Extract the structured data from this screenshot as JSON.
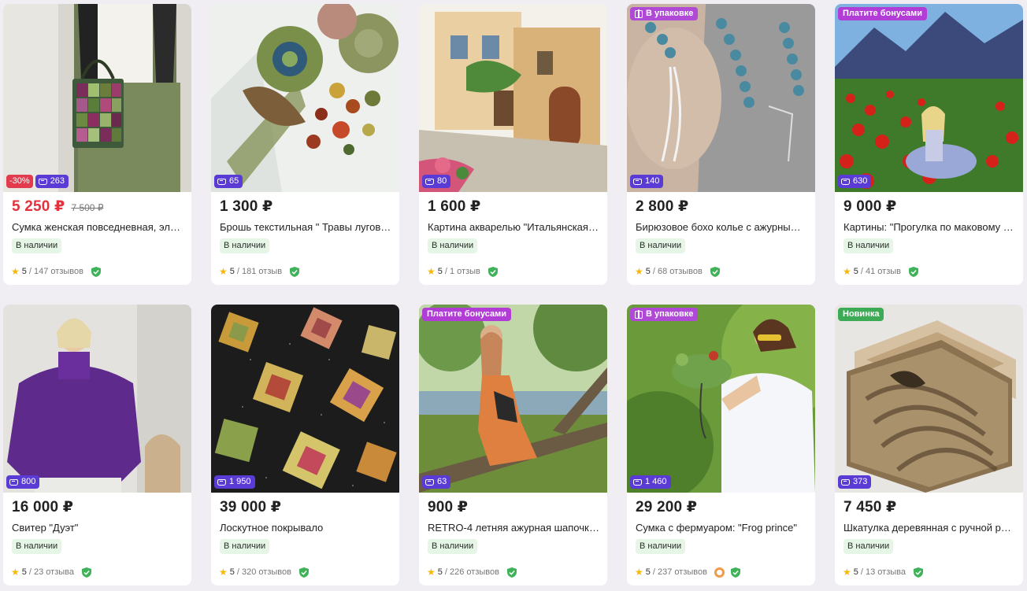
{
  "labels": {
    "in_stock": "В наличии",
    "tag_gift": "В упаковке",
    "tag_bonus": "Платите бонусами",
    "tag_new": "Новинка"
  },
  "colors": {
    "price_sale": "#e2323e",
    "orders_badge": "#5b3bd6",
    "discount_badge": "#e23b4d",
    "tag_gift": "#b04ad6",
    "tag_bonus": "#b23cd6",
    "tag_new": "#3daa55",
    "stock_bg": "#e5f6e6"
  },
  "products": [
    {
      "price": "5 250 ₽",
      "old_price": "7 500 ₽",
      "discount": "-30%",
      "orders": "263",
      "title": "Сумка женская повседневная, эле…",
      "score": "5",
      "reviews": "/ 147 отзывов",
      "image": "woman-with-patchwork-bag"
    },
    {
      "price": "1 300 ₽",
      "orders": "65",
      "title": "Брошь текстильная \" Травы лугов…",
      "score": "5",
      "reviews": "/ 181 отзыв",
      "image": "textile-flower-brooch"
    },
    {
      "price": "1 600 ₽",
      "orders": "80",
      "title": "Картина акварелью \"Итальянская …",
      "score": "5",
      "reviews": "/ 1 отзыв",
      "image": "watercolor-italian-street"
    },
    {
      "price": "2 800 ₽",
      "orders": "140",
      "tag": "В упаковке",
      "title": "Бирюзовое бохо колье с ажурным …",
      "score": "5",
      "reviews": "/ 68 отзывов",
      "image": "turquoise-necklace"
    },
    {
      "price": "9 000 ₽",
      "orders": "630",
      "tag": "Платите бонусами",
      "title": "Картины: \"Прогулка по маковому п…",
      "score": "5",
      "reviews": "/ 41 отзыв",
      "image": "poppy-field-painting"
    },
    {
      "price": "16 000 ₽",
      "orders": "800",
      "title": "Свитер \"Дуэт\"",
      "score": "5",
      "reviews": "/ 23 отзыва",
      "image": "purple-sweater"
    },
    {
      "price": "39 000 ₽",
      "orders": "1 950",
      "title": "Лоскутное покрывало",
      "score": "5",
      "reviews": "/ 320 отзывов",
      "image": "patchwork-quilt"
    },
    {
      "price": "900 ₽",
      "orders": "63",
      "tag": "Платите бонусами",
      "title": "RETRO-4 летняя ажурная шапочка …",
      "score": "5",
      "reviews": "/ 226 отзывов",
      "image": "woman-on-tree"
    },
    {
      "price": "29 200 ₽",
      "orders": "1 460",
      "tag": "В упаковке",
      "title": "Сумка с фермуаром: \"Frog prince\"",
      "score": "5",
      "reviews": "/ 237 отзывов",
      "medal": true,
      "image": "woman-with-frog-bag"
    },
    {
      "price": "7 450 ₽",
      "orders": "373",
      "tag": "Новинка",
      "title": "Шкатулка деревянная с ручной ре…",
      "score": "5",
      "reviews": "/ 13 отзыва",
      "image": "carved-wooden-box"
    }
  ]
}
